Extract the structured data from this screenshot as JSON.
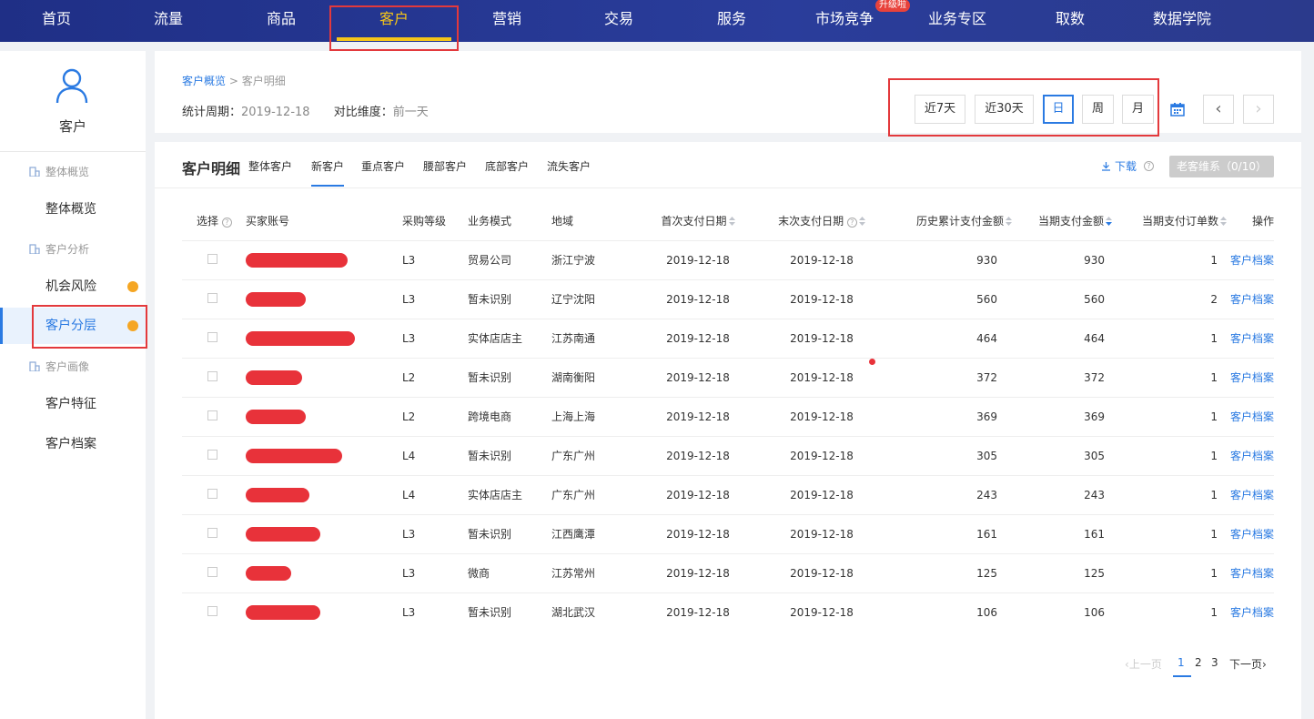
{
  "nav": {
    "items": [
      "首页",
      "流量",
      "商品",
      "客户",
      "营销",
      "交易",
      "服务",
      "市场竞争",
      "业务专区",
      "取数",
      "数据学院"
    ],
    "active_index": 3,
    "upgrade_badge": "升级啦"
  },
  "sidebar": {
    "title": "客户",
    "groups": [
      {
        "label": "整体概览",
        "items": [
          {
            "label": "整体概览",
            "dot": false
          }
        ]
      },
      {
        "label": "客户分析",
        "items": [
          {
            "label": "机会风险",
            "dot": true
          },
          {
            "label": "客户分层",
            "dot": true,
            "active": true
          }
        ]
      },
      {
        "label": "客户画像",
        "items": [
          {
            "label": "客户特征",
            "dot": false
          },
          {
            "label": "客户档案",
            "dot": false
          }
        ]
      }
    ]
  },
  "header": {
    "breadcrumb": {
      "parent": "客户概览",
      "sep": ">",
      "current": "客户明细"
    },
    "period_label": "统计周期：",
    "period_value": "2019-12-18",
    "compare_label": "对比维度：",
    "compare_value": "前一天",
    "date_buttons": [
      "近7天",
      "近30天",
      "日",
      "周",
      "月"
    ],
    "selected_date_button": "日",
    "prev_label": "‹",
    "next_label": "›"
  },
  "detail": {
    "title": "客户明细",
    "tabs": [
      "整体客户",
      "新客户",
      "重点客户",
      "腰部客户",
      "底部客户",
      "流失客户"
    ],
    "active_tab": "新客户",
    "download_label": "下载",
    "old_customer_button": "老客维系（0/10）",
    "columns": [
      "选择",
      "买家账号",
      "采购等级",
      "业务模式",
      "地域",
      "首次支付日期",
      "末次支付日期",
      "历史累计支付金额",
      "当期支付金额",
      "当期支付订单数",
      "操作"
    ],
    "rows": [
      {
        "level": "L3",
        "mode": "贸易公司",
        "region": "浙江宁波",
        "first": "2019-12-18",
        "last": "2019-12-18",
        "hist": "930",
        "cur": "930",
        "orders": "1",
        "action": "客户档案"
      },
      {
        "level": "L3",
        "mode": "暂未识别",
        "region": "辽宁沈阳",
        "first": "2019-12-18",
        "last": "2019-12-18",
        "hist": "560",
        "cur": "560",
        "orders": "2",
        "action": "客户档案"
      },
      {
        "level": "L3",
        "mode": "实体店店主",
        "region": "江苏南通",
        "first": "2019-12-18",
        "last": "2019-12-18",
        "hist": "464",
        "cur": "464",
        "orders": "1",
        "action": "客户档案"
      },
      {
        "level": "L2",
        "mode": "暂未识别",
        "region": "湖南衡阳",
        "first": "2019-12-18",
        "last": "2019-12-18",
        "hist": "372",
        "cur": "372",
        "orders": "1",
        "action": "客户档案"
      },
      {
        "level": "L2",
        "mode": "跨境电商",
        "region": "上海上海",
        "first": "2019-12-18",
        "last": "2019-12-18",
        "hist": "369",
        "cur": "369",
        "orders": "1",
        "action": "客户档案"
      },
      {
        "level": "L4",
        "mode": "暂未识别",
        "region": "广东广州",
        "first": "2019-12-18",
        "last": "2019-12-18",
        "hist": "305",
        "cur": "305",
        "orders": "1",
        "action": "客户档案"
      },
      {
        "level": "L4",
        "mode": "实体店店主",
        "region": "广东广州",
        "first": "2019-12-18",
        "last": "2019-12-18",
        "hist": "243",
        "cur": "243",
        "orders": "1",
        "action": "客户档案"
      },
      {
        "level": "L3",
        "mode": "暂未识别",
        "region": "江西鹰潭",
        "first": "2019-12-18",
        "last": "2019-12-18",
        "hist": "161",
        "cur": "161",
        "orders": "1",
        "action": "客户档案"
      },
      {
        "level": "L3",
        "mode": "微商",
        "region": "江苏常州",
        "first": "2019-12-18",
        "last": "2019-12-18",
        "hist": "125",
        "cur": "125",
        "orders": "1",
        "action": "客户档案"
      },
      {
        "level": "L3",
        "mode": "暂未识别",
        "region": "湖北武汉",
        "first": "2019-12-18",
        "last": "2019-12-18",
        "hist": "106",
        "cur": "106",
        "orders": "1",
        "action": "客户档案"
      }
    ]
  },
  "pager": {
    "prev": "上一页",
    "pages": [
      "1",
      "2",
      "3"
    ],
    "current": "1",
    "next": "下一页"
  },
  "colors": {
    "accent": "#2a7ae2",
    "nav_active": "#f5c518",
    "highlight_box": "#e3393c",
    "redaction": "#e8323a",
    "dot": "#f5a623"
  }
}
